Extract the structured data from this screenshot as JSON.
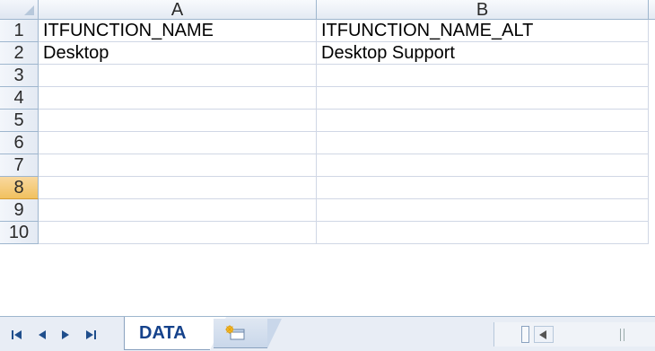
{
  "columns": [
    "A",
    "B"
  ],
  "rows": [
    "1",
    "2",
    "3",
    "4",
    "5",
    "6",
    "7",
    "8",
    "9"
  ],
  "partial_row": "10",
  "selected_row": "8",
  "cells": {
    "A1": "ITFUNCTION_NAME",
    "B1": "ITFUNCTION_NAME_ALT",
    "A2": "Desktop",
    "B2": "Desktop Support"
  },
  "sheet_tabs": [
    {
      "label": "DATA",
      "active": true
    }
  ],
  "nav": {
    "first": "⏮",
    "prev": "◀",
    "next": "▶",
    "last": "⏭"
  },
  "icons": {
    "select_all": "select-all-corner",
    "insert_sheet": "insert-sheet-icon"
  }
}
